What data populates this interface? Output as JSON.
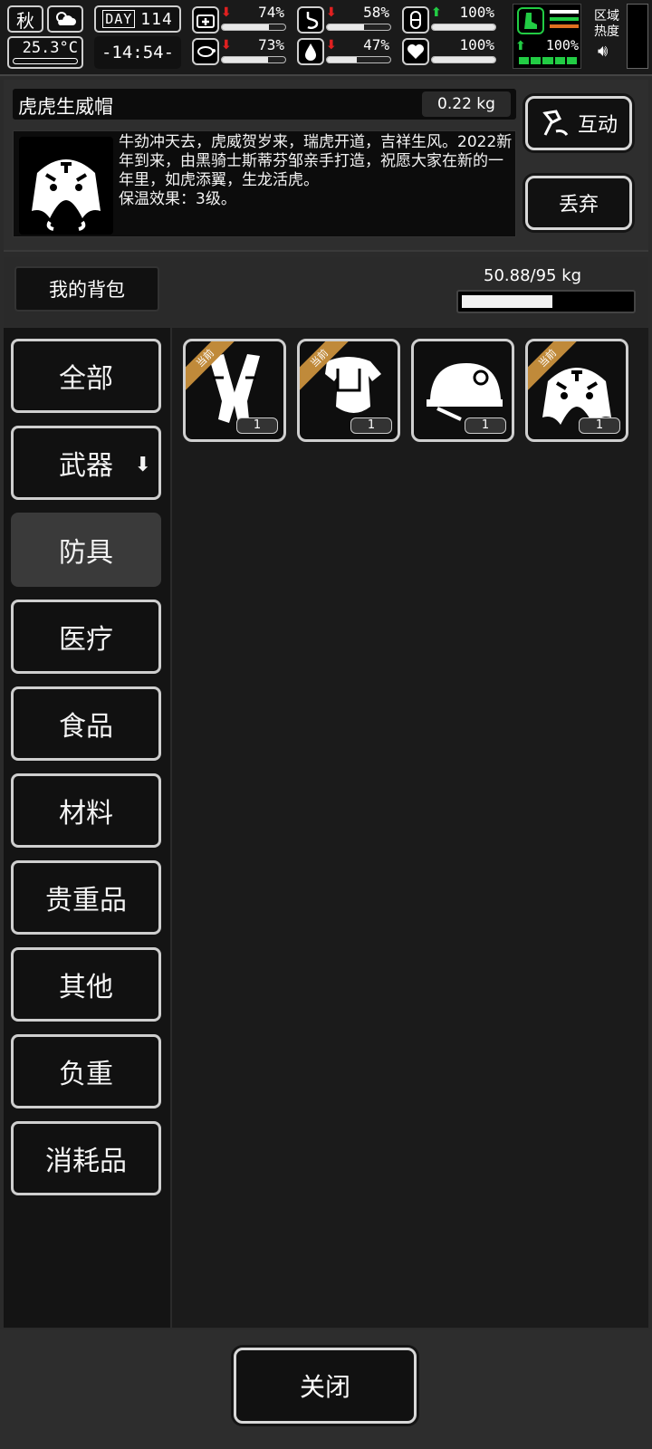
{
  "status": {
    "season": "秋",
    "temperature": "25.3°C",
    "day_label": "DAY",
    "day_value": "114",
    "time": "-14:54-",
    "stats": [
      {
        "name": "health",
        "icon": "first-aid-icon",
        "trend": "down",
        "percent_label": "74%",
        "percent": 74
      },
      {
        "name": "hunger",
        "icon": "stomach-icon",
        "trend": "down",
        "percent_label": "58%",
        "percent": 58
      },
      {
        "name": "energy",
        "icon": "pill-icon",
        "trend": "up",
        "percent_label": "100%",
        "percent": 100
      },
      {
        "name": "mood",
        "icon": "turtle-icon",
        "trend": "down",
        "percent_label": "73%",
        "percent": 73
      },
      {
        "name": "thirst",
        "icon": "water-drop-icon",
        "trend": "down",
        "percent_label": "47%",
        "percent": 47
      },
      {
        "name": "heart",
        "icon": "heart-icon",
        "trend": "none",
        "percent_label": "100%",
        "percent": 100
      },
      {
        "name": "stamina",
        "icon": "boot-icon",
        "trend": "up",
        "percent_label": "100%",
        "percent": 100
      }
    ],
    "zone_heat_label_line1": "区域",
    "zone_heat_label_line2": "热度",
    "colors": {
      "down": "#e02020",
      "up": "#22cc44",
      "stamina_green": "#22cc44",
      "stamina_orange": "#e07020"
    }
  },
  "item": {
    "name": "虎虎生威帽",
    "weight": "0.22 kg",
    "icon": "tiger-hat-icon",
    "description": "牛劲冲天去，虎威贺岁来，瑞虎开道，吉祥生风。2022新年到来，由黑骑士斯蒂芬邹亲手打造，祝愿大家在新的一年里，如虎添翼，生龙活虎。",
    "warmth": "保温效果：3级。",
    "interact_label": "互动",
    "discard_label": "丢弃"
  },
  "bag": {
    "label": "我的背包",
    "weight_text": "50.88/95 kg",
    "weight_fraction": 0.5356
  },
  "categories": [
    {
      "label": "全部",
      "active": false,
      "sub": false
    },
    {
      "label": "武器",
      "active": false,
      "sub": true
    },
    {
      "label": "防具",
      "active": true,
      "sub": false
    },
    {
      "label": "医疗",
      "active": false,
      "sub": false
    },
    {
      "label": "食品",
      "active": false,
      "sub": false
    },
    {
      "label": "材料",
      "active": false,
      "sub": false
    },
    {
      "label": "贵重品",
      "active": false,
      "sub": false
    },
    {
      "label": "其他",
      "active": false,
      "sub": false
    },
    {
      "label": "负重",
      "active": false,
      "sub": false
    },
    {
      "label": "消耗品",
      "active": false,
      "sub": false
    }
  ],
  "inventory": [
    {
      "icon": "leg-armor-icon",
      "equipped_label": "当前",
      "qty": "1"
    },
    {
      "icon": "body-armor-icon",
      "equipped_label": "当前",
      "qty": "1"
    },
    {
      "icon": "helmet-icon",
      "equipped_label": "",
      "qty": "1"
    },
    {
      "icon": "tiger-hat-icon",
      "equipped_label": "当前",
      "qty": "1"
    }
  ],
  "close_label": "关闭"
}
